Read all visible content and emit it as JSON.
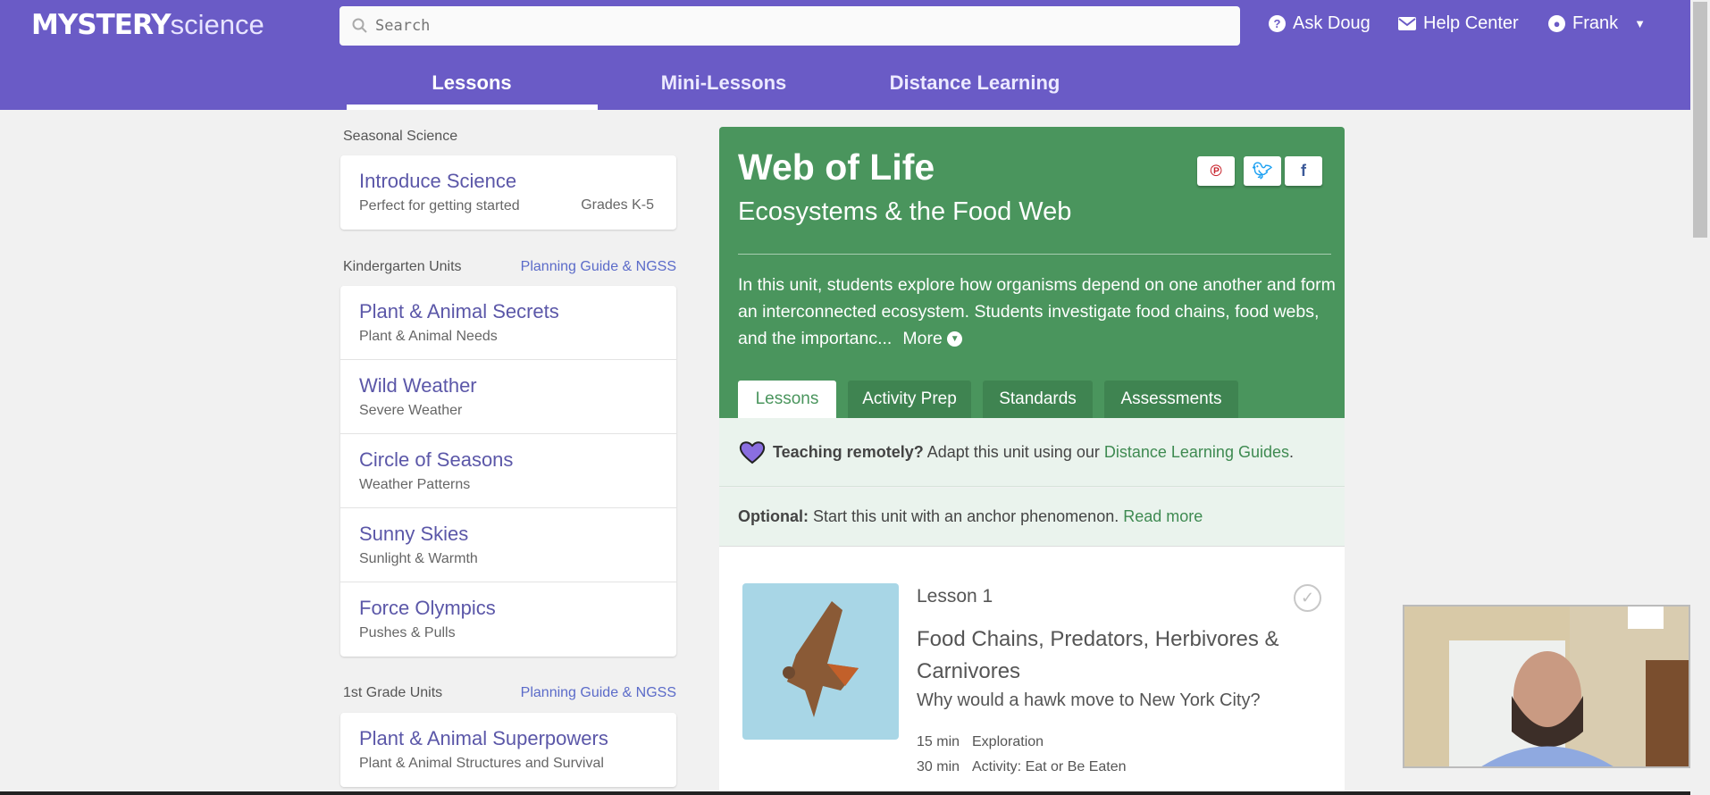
{
  "header": {
    "logo_bold": "MYSTERY",
    "logo_light": "science",
    "search_placeholder": "Search",
    "ask_doug": "Ask Doug",
    "help_center": "Help Center",
    "user": "Frank",
    "nav": [
      "Lessons",
      "Mini-Lessons",
      "Distance Learning"
    ]
  },
  "sidebar": {
    "seasonal_label": "Seasonal Science",
    "seasonal": {
      "title": "Introduce Science",
      "subtitle": "Perfect for getting started",
      "grades": "Grades K-5"
    },
    "kinder_label": "Kindergarten Units",
    "kinder_link": "Planning Guide & NGSS",
    "kinder_units": [
      {
        "title": "Plant & Animal Secrets",
        "subtitle": "Plant & Animal Needs"
      },
      {
        "title": "Wild Weather",
        "subtitle": "Severe Weather"
      },
      {
        "title": "Circle of Seasons",
        "subtitle": "Weather Patterns"
      },
      {
        "title": "Sunny Skies",
        "subtitle": "Sunlight & Warmth"
      },
      {
        "title": "Force Olympics",
        "subtitle": "Pushes & Pulls"
      }
    ],
    "first_label": "1st Grade Units",
    "first_link": "Planning Guide & NGSS",
    "first_units": [
      {
        "title": "Plant & Animal Superpowers",
        "subtitle": "Plant & Animal Structures and Survival"
      }
    ]
  },
  "unit": {
    "title": "Web of Life",
    "subtitle": "Ecosystems & the Food Web",
    "description": "In this unit, students explore how organisms depend on one another and form an interconnected ecosystem. Students investigate food chains, food webs, and the importanc...",
    "more": "More",
    "tabs": [
      "Lessons",
      "Activity Prep",
      "Standards",
      "Assessments"
    ],
    "remote_bold": "Teaching remotely?",
    "remote_text": " Adapt this unit using our ",
    "remote_link": "Distance Learning Guides",
    "remote_end": ".",
    "optional_bold": "Optional:",
    "optional_text": " Start this unit with an anchor phenomenon. ",
    "optional_link": "Read more"
  },
  "lesson": {
    "number": "Lesson 1",
    "title": "Food Chains, Predators, Herbivores & Carnivores",
    "question": "Why would a hawk move to New York City?",
    "activities": [
      {
        "time": "15 min",
        "name": "Exploration"
      },
      {
        "time": "30 min",
        "name": "Activity: Eat or Be Eaten"
      }
    ]
  },
  "colors": {
    "header": "#6a5bc6",
    "green": "#4a955d",
    "link": "#5b6bc9"
  }
}
